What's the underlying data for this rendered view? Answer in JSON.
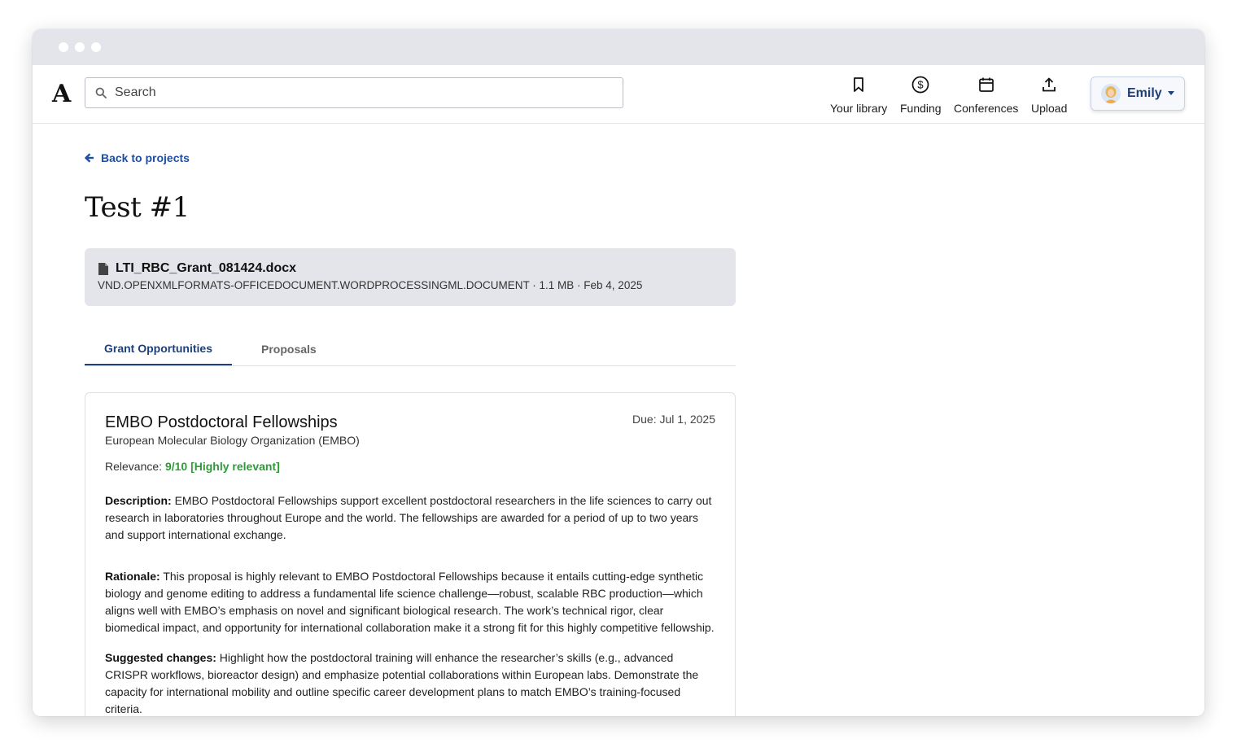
{
  "header": {
    "logo": "A",
    "search_placeholder": "Search",
    "nav": [
      {
        "label": "Your library",
        "icon": "bookmark-icon"
      },
      {
        "label": "Funding",
        "icon": "dollar-icon"
      },
      {
        "label": "Conferences",
        "icon": "calendar-icon"
      },
      {
        "label": "Upload",
        "icon": "upload-icon"
      }
    ],
    "user": {
      "name": "Emily",
      "icon": "avatar"
    }
  },
  "back_link": "Back to projects",
  "project_title": "Test #1",
  "file": {
    "name": "LTI_RBC_Grant_081424.docx",
    "meta": "VND.OPENXMLFORMATS-OFFICEDOCUMENT.WORDPROCESSINGML.DOCUMENT · 1.1 MB · Feb 4, 2025"
  },
  "tabs": [
    {
      "label": "Grant Opportunities",
      "active": true
    },
    {
      "label": "Proposals",
      "active": false
    }
  ],
  "grant": {
    "title": "EMBO Postdoctoral Fellowships",
    "org": "European Molecular Biology Organization (EMBO)",
    "due": "Due: Jul 1, 2025",
    "relevance_label": "Relevance: ",
    "relevance_value": "9/10 [Highly relevant]",
    "description_label": "Description:",
    "description": " EMBO Postdoctoral Fellowships support excellent postdoctoral researchers in the life sciences to carry out research in laboratories throughout Europe and the world. The fellowships are awarded for a period of up to two years and support international exchange.",
    "rationale_label": "Rationale:",
    "rationale": " This proposal is highly relevant to EMBO Postdoctoral Fellowships because it entails cutting-edge synthetic biology and genome editing to address a fundamental life science challenge—robust, scalable RBC production—which aligns well with EMBO’s emphasis on novel and significant biological research. The work’s technical rigor, clear biomedical impact, and opportunity for international collaboration make it a strong fit for this highly competitive fellowship.",
    "suggested_label": "Suggested changes:",
    "suggested": " Highlight how the postdoctoral training will enhance the researcher’s skills (e.g., advanced CRISPR workflows, bioreactor design) and emphasize potential collaborations within European labs. Demonstrate the capacity for international mobility and outline specific career development plans to match EMBO’s training-focused criteria."
  },
  "colors": {
    "accent": "#1f3f7a",
    "link": "#1f4ea3",
    "relevance": "#2e9a3a",
    "file_card_bg": "#e3e5ea"
  }
}
